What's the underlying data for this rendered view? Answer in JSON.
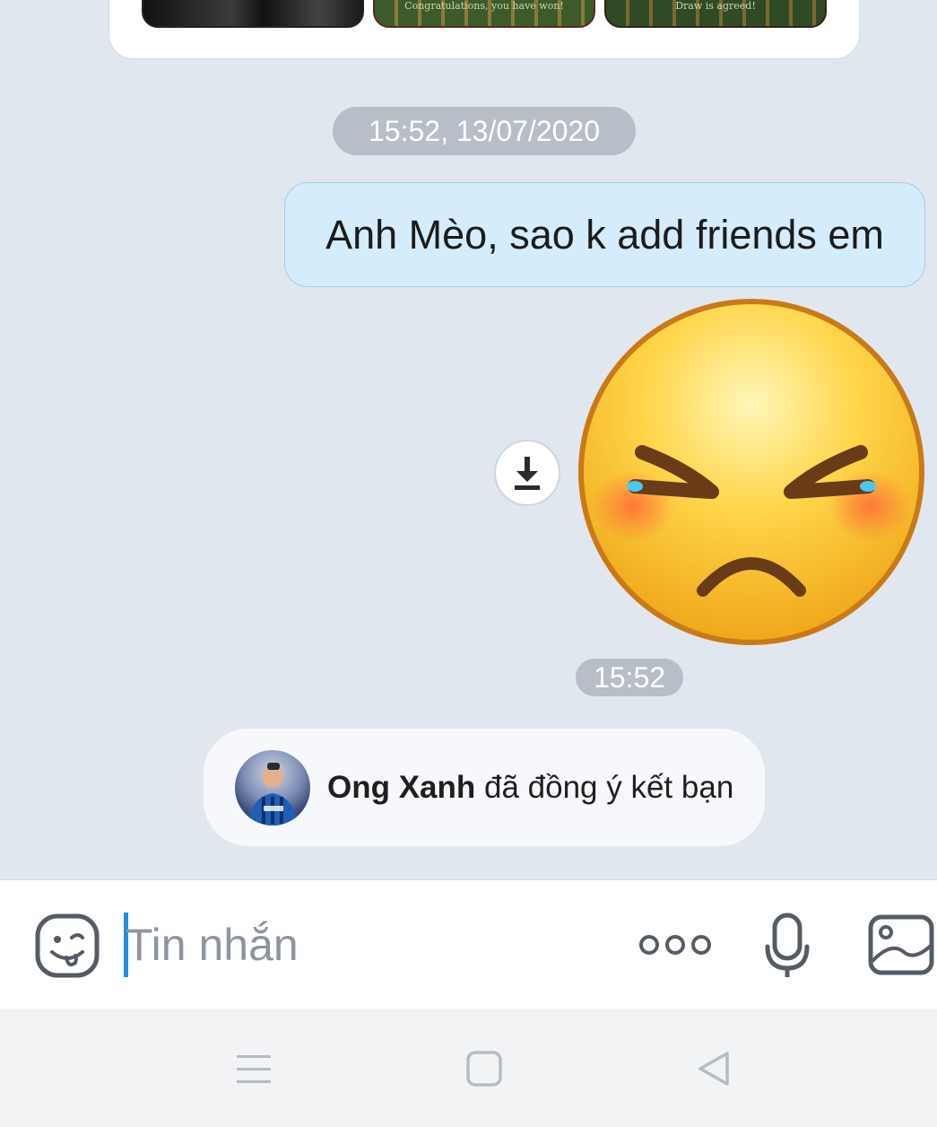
{
  "chat": {
    "prev_thumbnails": [
      {
        "caption": ""
      },
      {
        "caption": "Congratulations, you have won!"
      },
      {
        "caption": "Draw is agreed!"
      }
    ],
    "timestamp_1": "15:52, 13/07/2020",
    "outgoing_message": "Anh Mèo, sao k add friends em",
    "sticker_icon": "angry-face-emoji",
    "download_icon": "download-icon",
    "timestamp_2": "15:52",
    "friend_notice": {
      "name": "Ong Xanh",
      "text": " đã đồng ý kết bạn"
    }
  },
  "composer": {
    "placeholder": "Tin nhắn",
    "icons": [
      "sticker-icon",
      "more-icon",
      "mic-icon",
      "image-icon"
    ]
  },
  "navbar": {
    "icons": [
      "menu-icon",
      "home-icon",
      "back-icon"
    ]
  },
  "colors": {
    "background": "#e1e7ef",
    "outgoing_bubble": "#d4ecfb",
    "timestamp_pill": "#b7bec7",
    "accent_caret": "#1f8fe8"
  }
}
